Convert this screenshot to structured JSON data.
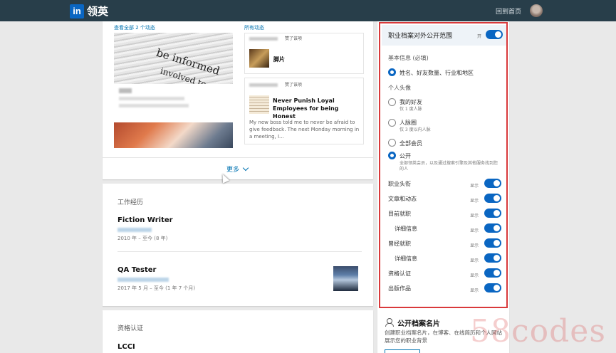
{
  "app": {
    "logo_text": "in",
    "brand": "领英",
    "home_link": "回到首页"
  },
  "activity": {
    "see_all_left": "查看全部 2 个动态",
    "see_all_right": "所有动态",
    "newspaper_words": [
      "be informed",
      "involved to"
    ],
    "feed": [
      {
        "action": "赞了该项",
        "title": "脚片"
      },
      {
        "action": "赞了该项",
        "title": "Never Punish Loyal Employees for being Honest",
        "body": "My new boss told me to never be afraid to give feedback. The next Monday morning in a meeting, I..."
      }
    ],
    "more_label": "更多"
  },
  "experience": {
    "heading": "工作经历",
    "jobs": [
      {
        "title": "Fiction Writer",
        "dates": "2010 年 – 至今 (8 年)"
      },
      {
        "title": "QA Tester",
        "dates": "2017 年 5 月 – 至今 (1 年 7 个月)"
      }
    ]
  },
  "certifications": {
    "heading": "资格认证",
    "items": [
      "LCCI"
    ]
  },
  "visibility_panel": {
    "title": "职业档案对外公开范围",
    "state_label": "开",
    "basic_info_label": "基本信息 (必填)",
    "basic_info_value": "姓名、好友数量、行业和地区",
    "photo_label": "个人头像",
    "photo_options": [
      {
        "label": "我的好友",
        "sub": "仅 1 度人脉",
        "selected": false
      },
      {
        "label": "人脉圈",
        "sub": "仅 3 度以内人脉",
        "selected": false
      },
      {
        "label": "全部会员",
        "sub": "",
        "selected": false
      },
      {
        "label": "公开",
        "sub": "全部领英会员，以及通过搜索引擎及其他服务找到您的人",
        "selected": true
      }
    ],
    "sections": [
      {
        "label": "职业头衔",
        "state": "显示",
        "on": true
      },
      {
        "label": "文章和动态",
        "state": "显示",
        "on": true
      },
      {
        "label": "目前就职",
        "state": "显示",
        "on": true
      },
      {
        "label": "详细信息",
        "state": "显示",
        "on": true,
        "indent": true
      },
      {
        "label": "曾经就职",
        "state": "显示",
        "on": true
      },
      {
        "label": "详细信息",
        "state": "显示",
        "on": true,
        "indent": true
      },
      {
        "label": "资格认证",
        "state": "显示",
        "on": true
      },
      {
        "label": "出版作品",
        "state": "显示",
        "on": true
      }
    ],
    "accent": "#0a66c2",
    "highlight_border": "#d9393b"
  },
  "name_card": {
    "title": "公开档案名片",
    "desc": "创建职业档案名片，在博客、在线简历和个人网站展示您的职业背景"
  },
  "watermark": "58codes"
}
